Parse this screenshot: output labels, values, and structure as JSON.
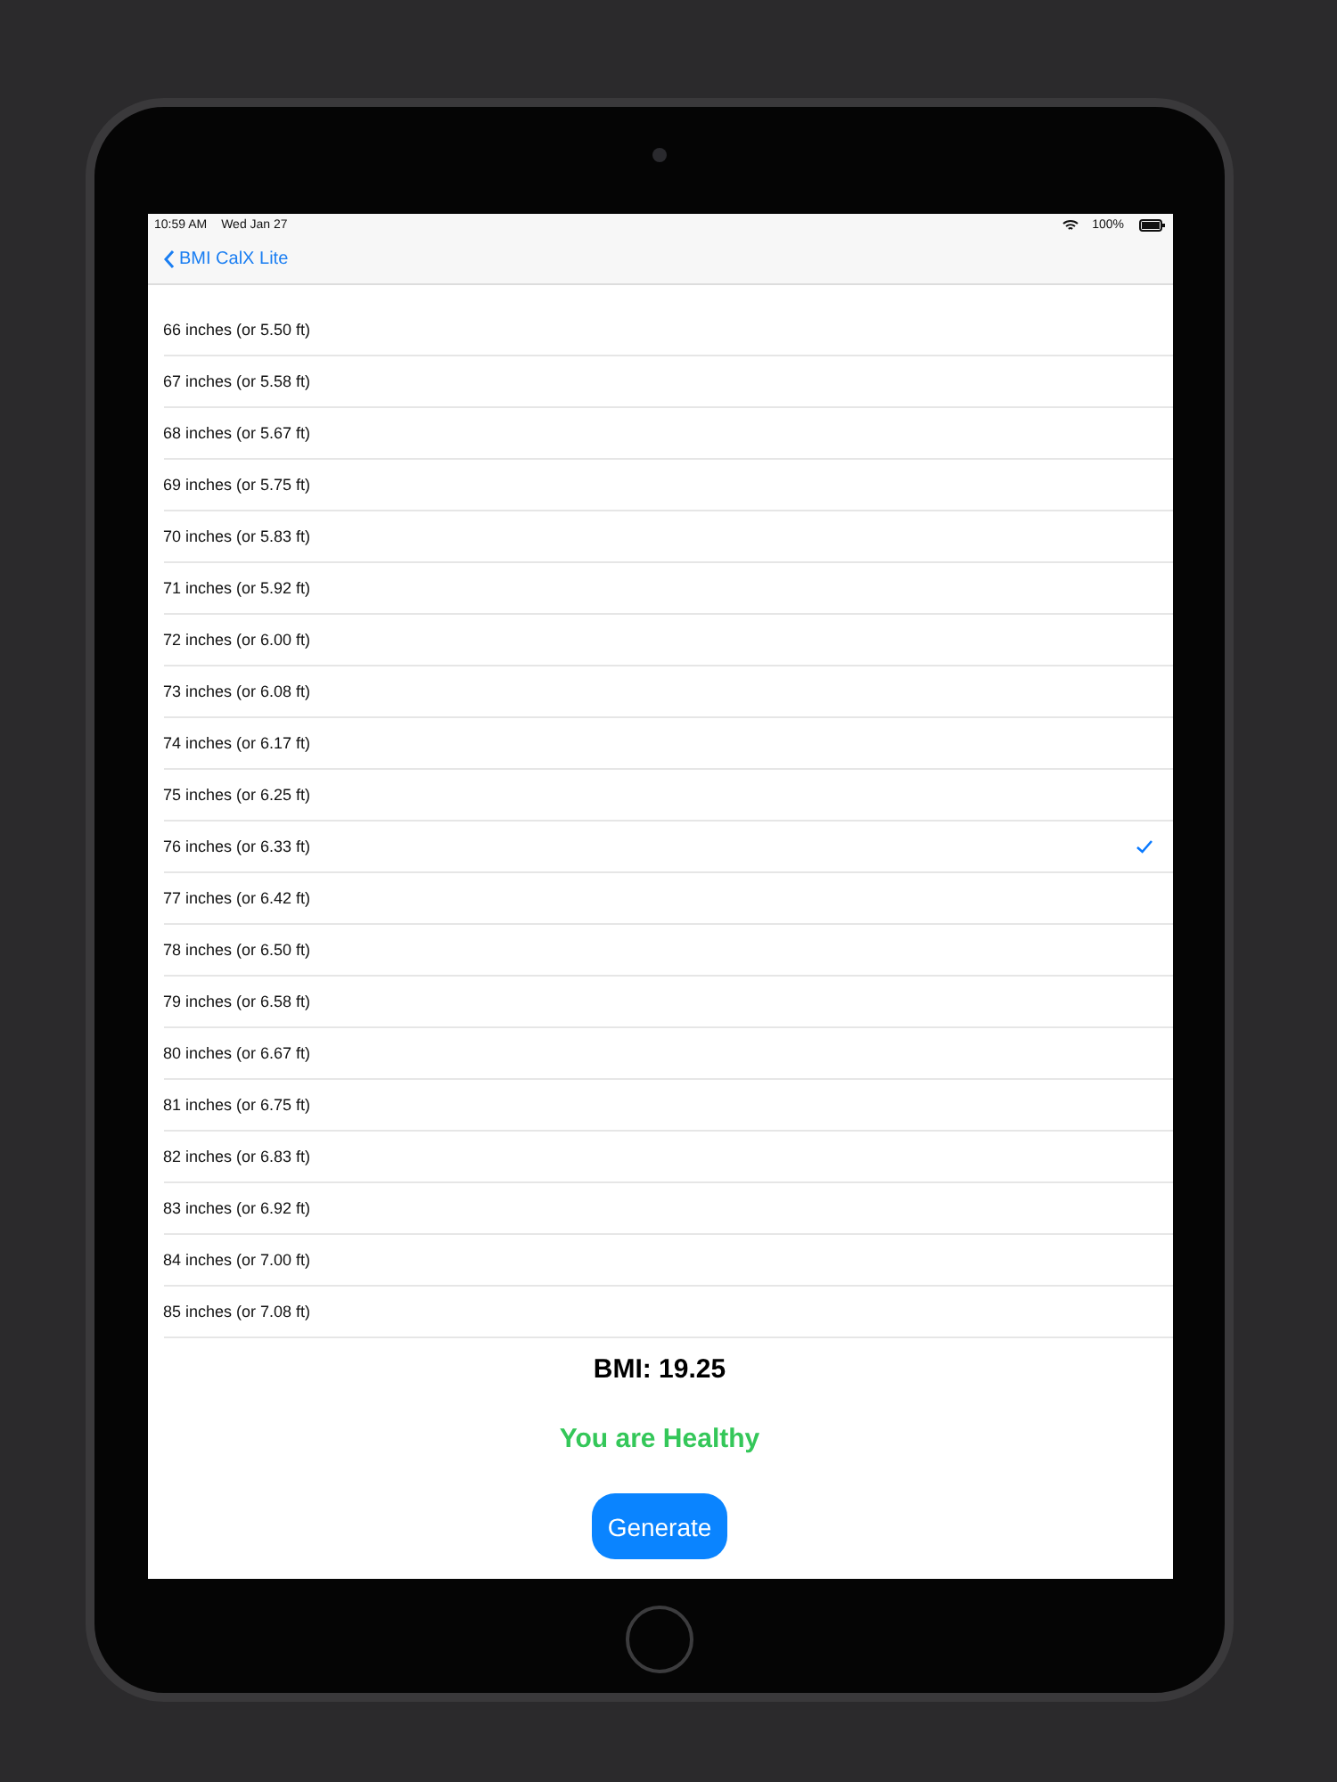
{
  "status_bar": {
    "time": "10:59 AM",
    "date": "Wed Jan 27",
    "battery": "100%"
  },
  "nav": {
    "back_label": "BMI CalX Lite"
  },
  "heights": [
    {
      "label": "66 inches (or 5.50 ft)",
      "selected": false
    },
    {
      "label": "67 inches (or 5.58 ft)",
      "selected": false
    },
    {
      "label": "68 inches (or 5.67 ft)",
      "selected": false
    },
    {
      "label": "69 inches (or 5.75 ft)",
      "selected": false
    },
    {
      "label": "70 inches (or 5.83 ft)",
      "selected": false
    },
    {
      "label": "71 inches (or 5.92 ft)",
      "selected": false
    },
    {
      "label": "72 inches (or 6.00 ft)",
      "selected": false
    },
    {
      "label": "73 inches (or 6.08 ft)",
      "selected": false
    },
    {
      "label": "74 inches (or 6.17 ft)",
      "selected": false
    },
    {
      "label": "75 inches (or 6.25 ft)",
      "selected": false
    },
    {
      "label": "76 inches (or 6.33 ft)",
      "selected": true
    },
    {
      "label": "77 inches (or 6.42 ft)",
      "selected": false
    },
    {
      "label": "78 inches (or 6.50 ft)",
      "selected": false
    },
    {
      "label": "79 inches (or 6.58 ft)",
      "selected": false
    },
    {
      "label": "80 inches (or 6.67 ft)",
      "selected": false
    },
    {
      "label": "81 inches (or 6.75 ft)",
      "selected": false
    },
    {
      "label": "82 inches (or 6.83 ft)",
      "selected": false
    },
    {
      "label": "83 inches (or 6.92 ft)",
      "selected": false
    },
    {
      "label": "84 inches (or 7.00 ft)",
      "selected": false
    },
    {
      "label": "85 inches (or 7.08 ft)",
      "selected": false
    }
  ],
  "result": {
    "bmi": "BMI: 19.25",
    "status": "You are Healthy",
    "color": "#34c759"
  },
  "button": "Generate"
}
